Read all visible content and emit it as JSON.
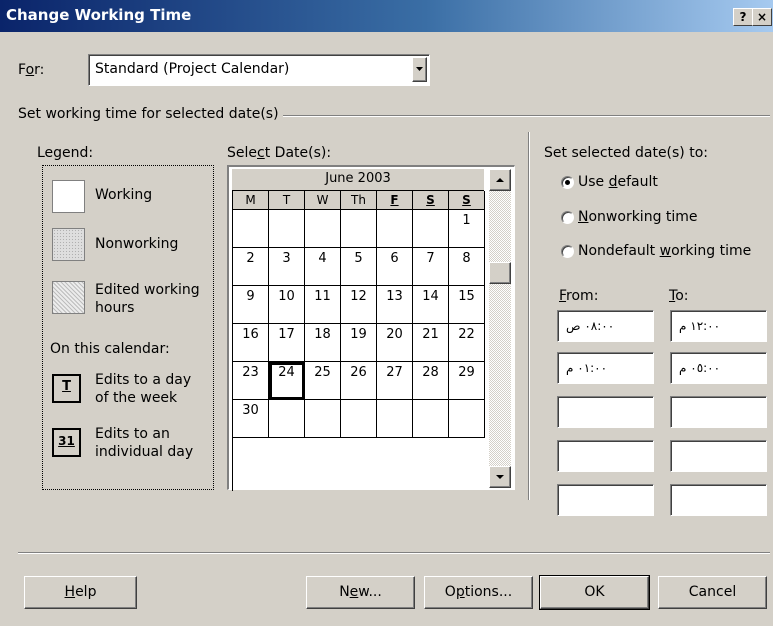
{
  "window": {
    "title": "Change Working Time",
    "help_btn": "?",
    "close_btn": "×"
  },
  "for_row": {
    "label": "For:",
    "value": "Standard (Project Calendar)"
  },
  "group_title": "Set working time for selected date(s)",
  "legend": {
    "title": "Legend:",
    "working": "Working",
    "nonworking": "Nonworking",
    "edited": "Edited working hours",
    "on_calendar": "On this calendar:",
    "day_of_week_glyph": "T",
    "day_of_week": "Edits to a day of the week",
    "individual_glyph": "31",
    "individual": "Edits to an individual day"
  },
  "calendar": {
    "label": "Select Date(s):",
    "month": "June 2003",
    "weekdays": [
      "M",
      "T",
      "W",
      "Th",
      "F",
      "S",
      "S"
    ],
    "weeks": [
      [
        "",
        "",
        "",
        "",
        "",
        "",
        "1"
      ],
      [
        "2",
        "3",
        "4",
        "5",
        "6",
        "7",
        "8"
      ],
      [
        "9",
        "10",
        "11",
        "12",
        "13",
        "14",
        "15"
      ],
      [
        "16",
        "17",
        "18",
        "19",
        "20",
        "21",
        "22"
      ],
      [
        "23",
        "24",
        "25",
        "26",
        "27",
        "28",
        "29"
      ],
      [
        "30",
        "",
        "",
        "",
        "",
        "",
        ""
      ]
    ],
    "selected_day": "24"
  },
  "set_to": {
    "title": "Set selected date(s) to:",
    "options": [
      "Use default",
      "Nonworking time",
      "Nondefault working time"
    ],
    "selected_option": "Use default",
    "from_label": "From:",
    "to_label": "To:",
    "rows": [
      {
        "from": "٠٨:٠٠ ص",
        "to": "١٢:٠٠ م"
      },
      {
        "from": "٠١:٠٠ م",
        "to": "٠٥:٠٠ م"
      },
      {
        "from": "",
        "to": ""
      },
      {
        "from": "",
        "to": ""
      },
      {
        "from": "",
        "to": ""
      }
    ]
  },
  "buttons": {
    "help": "Help",
    "new": "New...",
    "options": "Options...",
    "ok": "OK",
    "cancel": "Cancel"
  }
}
